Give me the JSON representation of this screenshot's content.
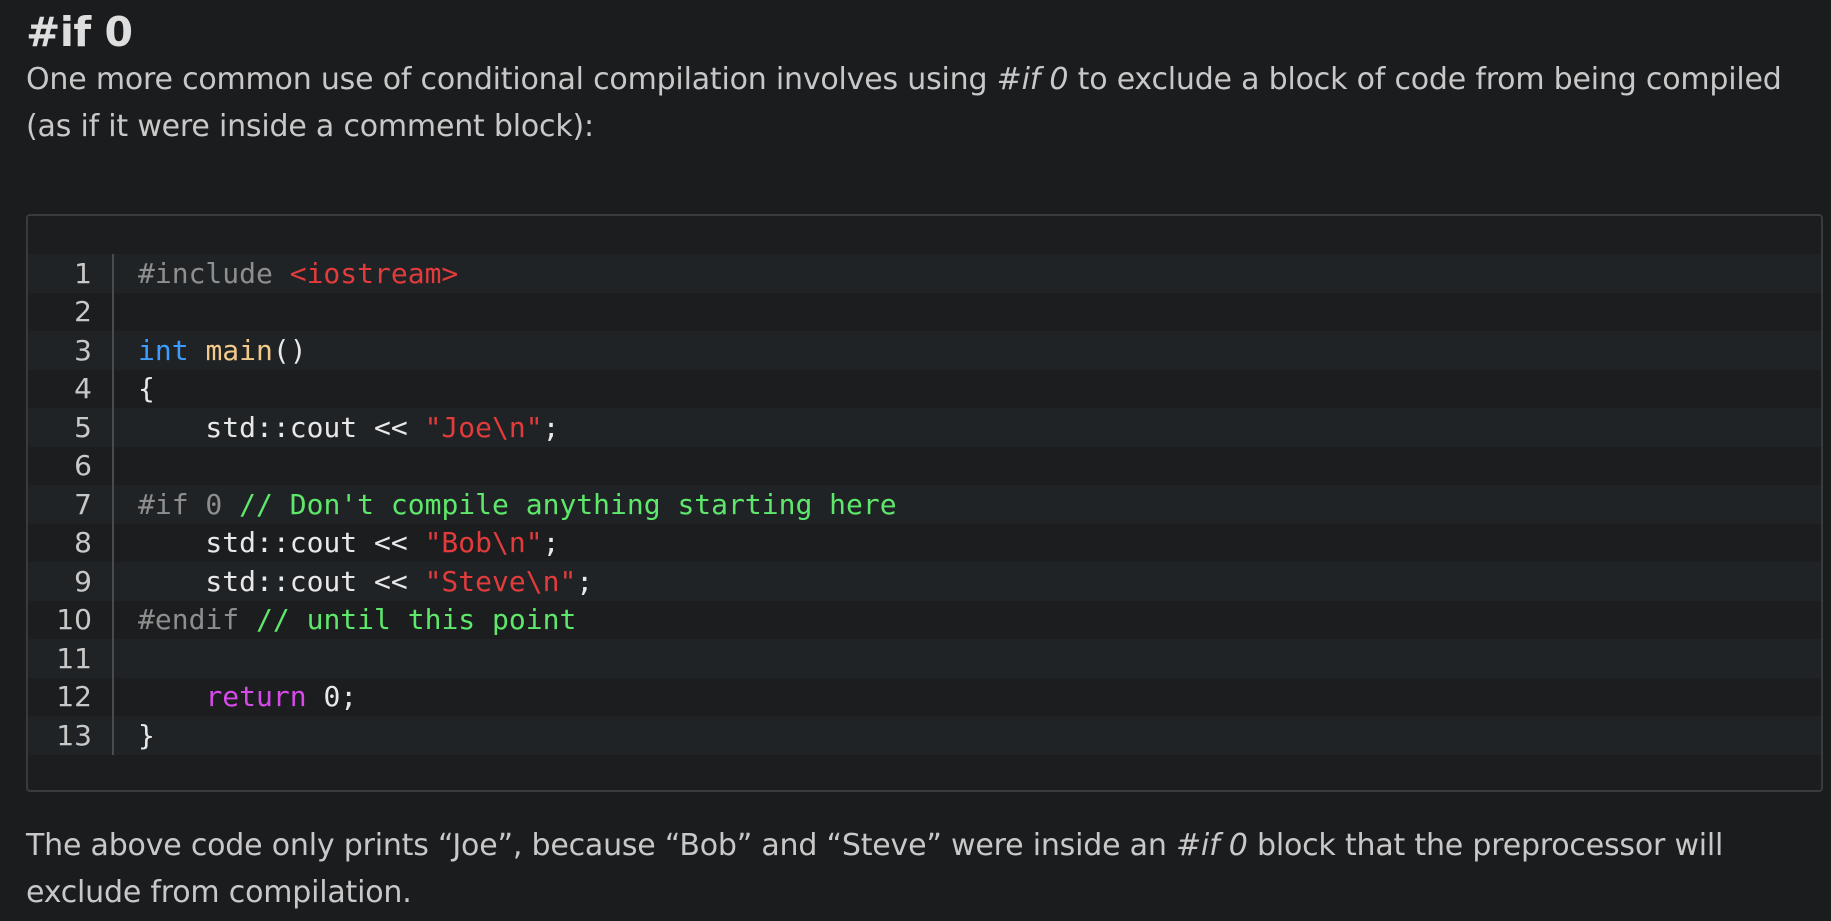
{
  "heading": "#if 0",
  "intro": {
    "before": "One more common use of conditional compilation involves using ",
    "em": "#if 0",
    "after": " to exclude a block of code from being compiled (as if it were inside a comment block):"
  },
  "code": {
    "lines": [
      {
        "n": "1",
        "tokens": [
          {
            "t": "#include ",
            "c": "pp"
          },
          {
            "t": "<iostream>",
            "c": "inc"
          }
        ]
      },
      {
        "n": "2",
        "tokens": []
      },
      {
        "n": "3",
        "tokens": [
          {
            "t": "int",
            "c": "kw"
          },
          {
            "t": " ",
            "c": "pl"
          },
          {
            "t": "main",
            "c": "fn"
          },
          {
            "t": "()",
            "c": "pl"
          }
        ]
      },
      {
        "n": "4",
        "tokens": [
          {
            "t": "{",
            "c": "pl"
          }
        ]
      },
      {
        "n": "5",
        "tokens": [
          {
            "t": "    std::cout << ",
            "c": "pl"
          },
          {
            "t": "\"Joe\\n\"",
            "c": "str"
          },
          {
            "t": ";",
            "c": "pl"
          }
        ]
      },
      {
        "n": "6",
        "tokens": []
      },
      {
        "n": "7",
        "tokens": [
          {
            "t": "#if 0",
            "c": "pp"
          },
          {
            "t": " // Don't compile anything starting here",
            "c": "cm"
          }
        ]
      },
      {
        "n": "8",
        "tokens": [
          {
            "t": "    std::cout << ",
            "c": "pl"
          },
          {
            "t": "\"Bob\\n\"",
            "c": "str"
          },
          {
            "t": ";",
            "c": "pl"
          }
        ]
      },
      {
        "n": "9",
        "tokens": [
          {
            "t": "    std::cout << ",
            "c": "pl"
          },
          {
            "t": "\"Steve\\n\"",
            "c": "str"
          },
          {
            "t": ";",
            "c": "pl"
          }
        ]
      },
      {
        "n": "10",
        "tokens": [
          {
            "t": "#endif",
            "c": "pp"
          },
          {
            "t": " // until this point",
            "c": "cm"
          }
        ]
      },
      {
        "n": "11",
        "tokens": []
      },
      {
        "n": "12",
        "tokens": [
          {
            "t": "    ",
            "c": "pl"
          },
          {
            "t": "return",
            "c": "ret"
          },
          {
            "t": " 0;",
            "c": "pl"
          }
        ]
      },
      {
        "n": "13",
        "tokens": [
          {
            "t": "}",
            "c": "pl"
          }
        ]
      }
    ]
  },
  "outro": {
    "before": "The above code only prints “Joe”, because “Bob” and “Steve” were inside an ",
    "em": "#if 0",
    "after": " block that the preprocessor will exclude from compilation."
  },
  "colors": {
    "background": "#1b1c1e",
    "keyword": "#3d9cff",
    "function": "#f1c98a",
    "string": "#e23b3b",
    "comment": "#5ee86b",
    "preprocessor": "#8e8e8e",
    "return_keyword": "#d54ae8"
  }
}
